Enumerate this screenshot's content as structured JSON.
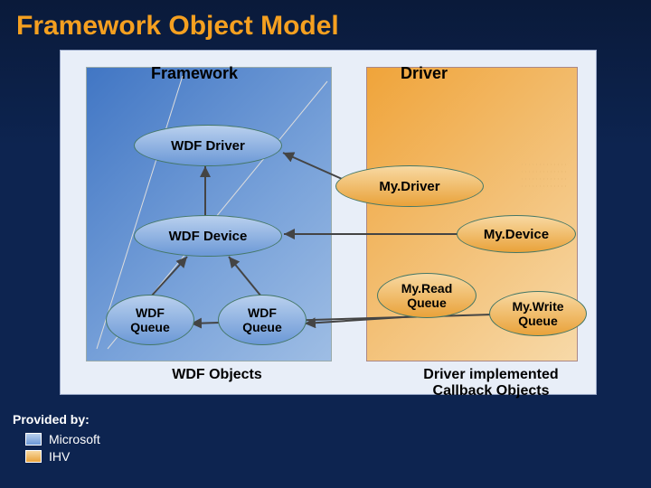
{
  "title": "Framework Object Model",
  "panels": {
    "framework": "Framework",
    "driver": "Driver"
  },
  "nodes": {
    "wdf_driver": "WDF Driver",
    "my_driver": "My.Driver",
    "wdf_device": "WDF Device",
    "my_device": "My.Device",
    "wdf_queue_1": "WDF\nQueue",
    "wdf_queue_2": "WDF\nQueue",
    "my_read_queue": "My.Read\nQueue",
    "my_write_queue": "My.Write\nQueue"
  },
  "bottom": {
    "left": "WDF Objects",
    "right": "Driver implemented Callback Objects"
  },
  "legend": {
    "provided_by": "Provided by:",
    "microsoft": "Microsoft",
    "ihv": "IHV"
  },
  "colors": {
    "title": "#f5a020",
    "bg_dark": "#0d2450",
    "panel_blue": "#4176c4",
    "panel_orange": "#f0a43a"
  }
}
